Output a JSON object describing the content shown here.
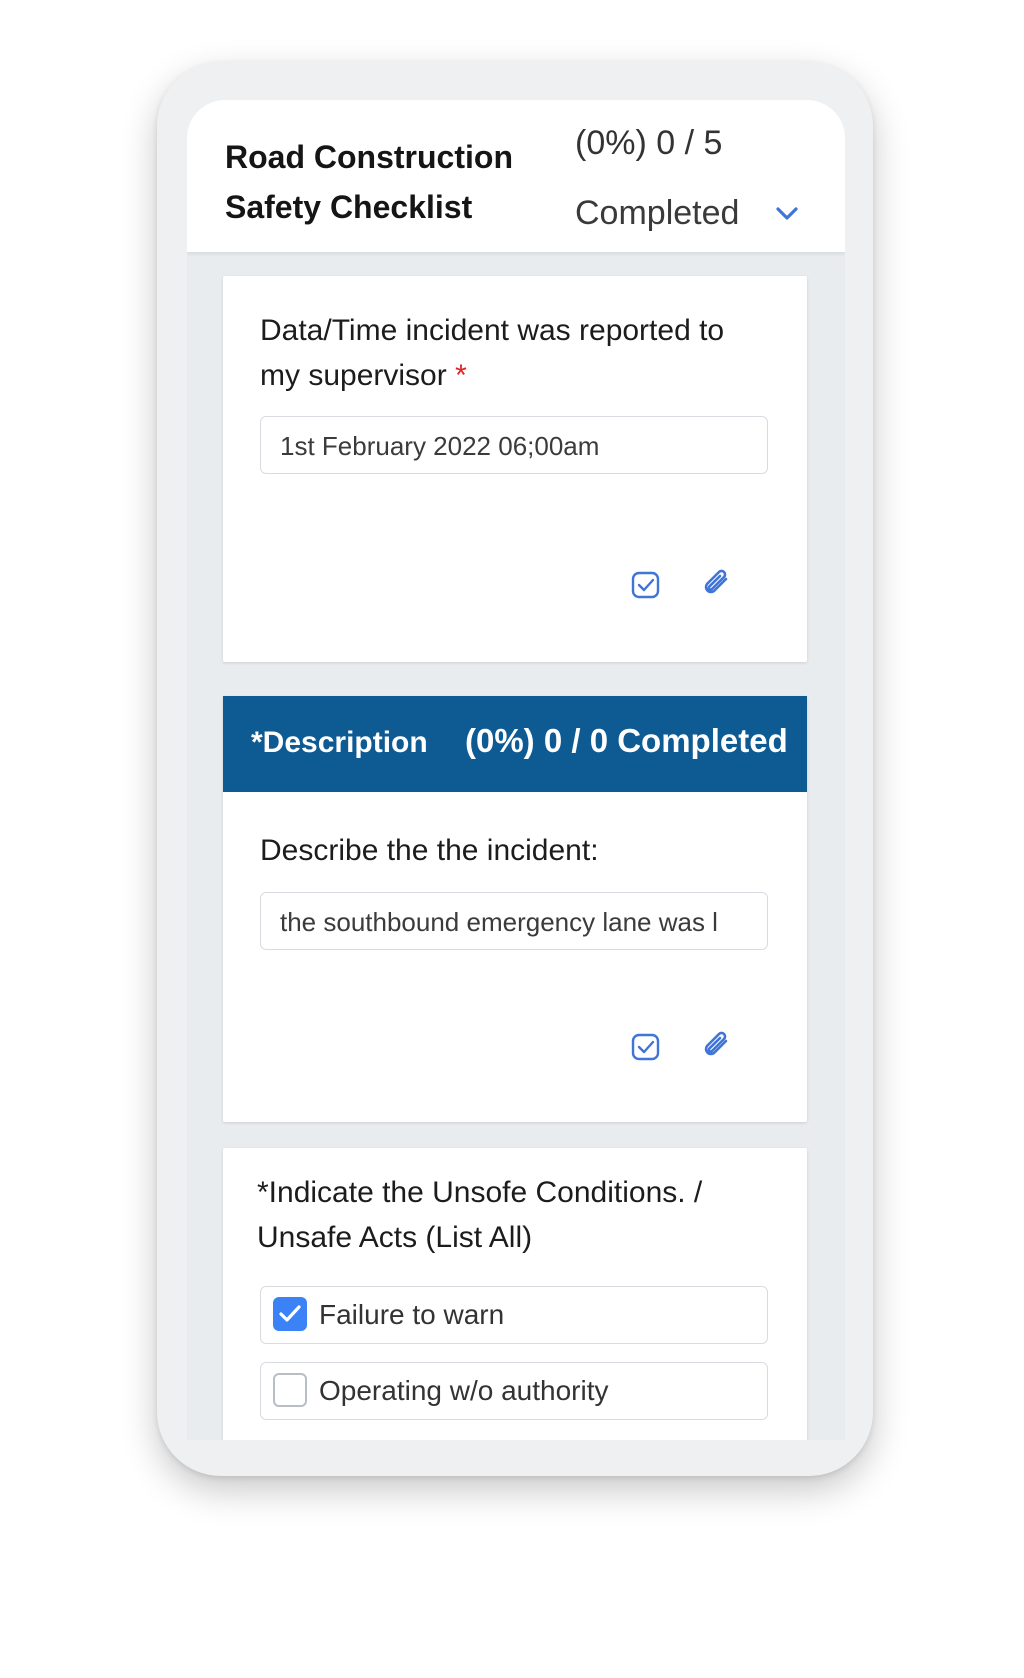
{
  "header": {
    "title_line1": "Road Construction",
    "title_line2": "Safety Checklist",
    "progress_count": "(0%) 0 / 5",
    "progress_status": "Completed",
    "chevron_icon": "chevron-down-icon"
  },
  "cards": [
    {
      "question": "Data/Time incident was reported to my supervisor",
      "required_mark": "*",
      "answer": "1st February 2022  06;00am",
      "icons": [
        "checkbox-edit-icon",
        "paperclip-icon"
      ]
    }
  ],
  "section": {
    "title": "*Description",
    "progress": "(0%) 0 / 0 Completed",
    "question": "Describe the the incident:",
    "answer": "the southbound emergency lane was l",
    "icons": [
      "checkbox-edit-icon",
      "paperclip-icon"
    ]
  },
  "conditions": {
    "question_line1": "*Indicate the Unsofe Conditions. /",
    "question_line2": "Unsafe Acts (List All)",
    "options": [
      {
        "label": "Failure to warn",
        "checked": true
      },
      {
        "label": "Operating w/o authority",
        "checked": false
      }
    ]
  },
  "colors": {
    "accent": "#3b82f6",
    "section_header": "#0e5a93",
    "icon_blue": "#3f74d8",
    "required": "#e02323"
  }
}
